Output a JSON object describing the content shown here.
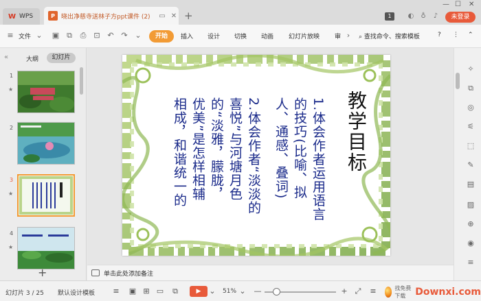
{
  "titlebar": {
    "app_tab_label": "WPS",
    "doc_tab_title": "晓出净慈寺送林子方ppt课件 (2)",
    "account_badge": "1",
    "login_label": "未登录"
  },
  "ribbon": {
    "file_menu": "文件",
    "tabs": [
      "开始",
      "插入",
      "设计",
      "切换",
      "动画",
      "幻灯片放映",
      "审"
    ],
    "search_label": "查找命令、搜索模板",
    "help_label": "?"
  },
  "left_panel": {
    "tab_outline": "大纲",
    "tab_slides": "幻灯片",
    "slide_numbers": [
      "1",
      "2",
      "3",
      "4"
    ],
    "active_slide": 3
  },
  "slide": {
    "title": "教学目标",
    "lines": [
      "1.体会作者运用语言",
      "的技巧(比喻、拟",
      "人、通感、叠词)",
      "2.体会作者“淡淡的",
      "喜悦”与河塘月色",
      "的“淡雅，朦胧，",
      "优美”是怎样相辅",
      "相成，和谐统一的"
    ]
  },
  "notes": {
    "placeholder": "单击此处添加备注"
  },
  "statusbar": {
    "slide_indicator": "幻灯片 3 / 25",
    "template_label": "默认设计模板",
    "zoom_level": "51%",
    "watermark_site": "Downxi.com",
    "watermark_sub": "找免费下载"
  },
  "colors": {
    "accent": "#f29b35",
    "brand_red": "#e85a3a",
    "slide_text": "#1a2a8a"
  }
}
